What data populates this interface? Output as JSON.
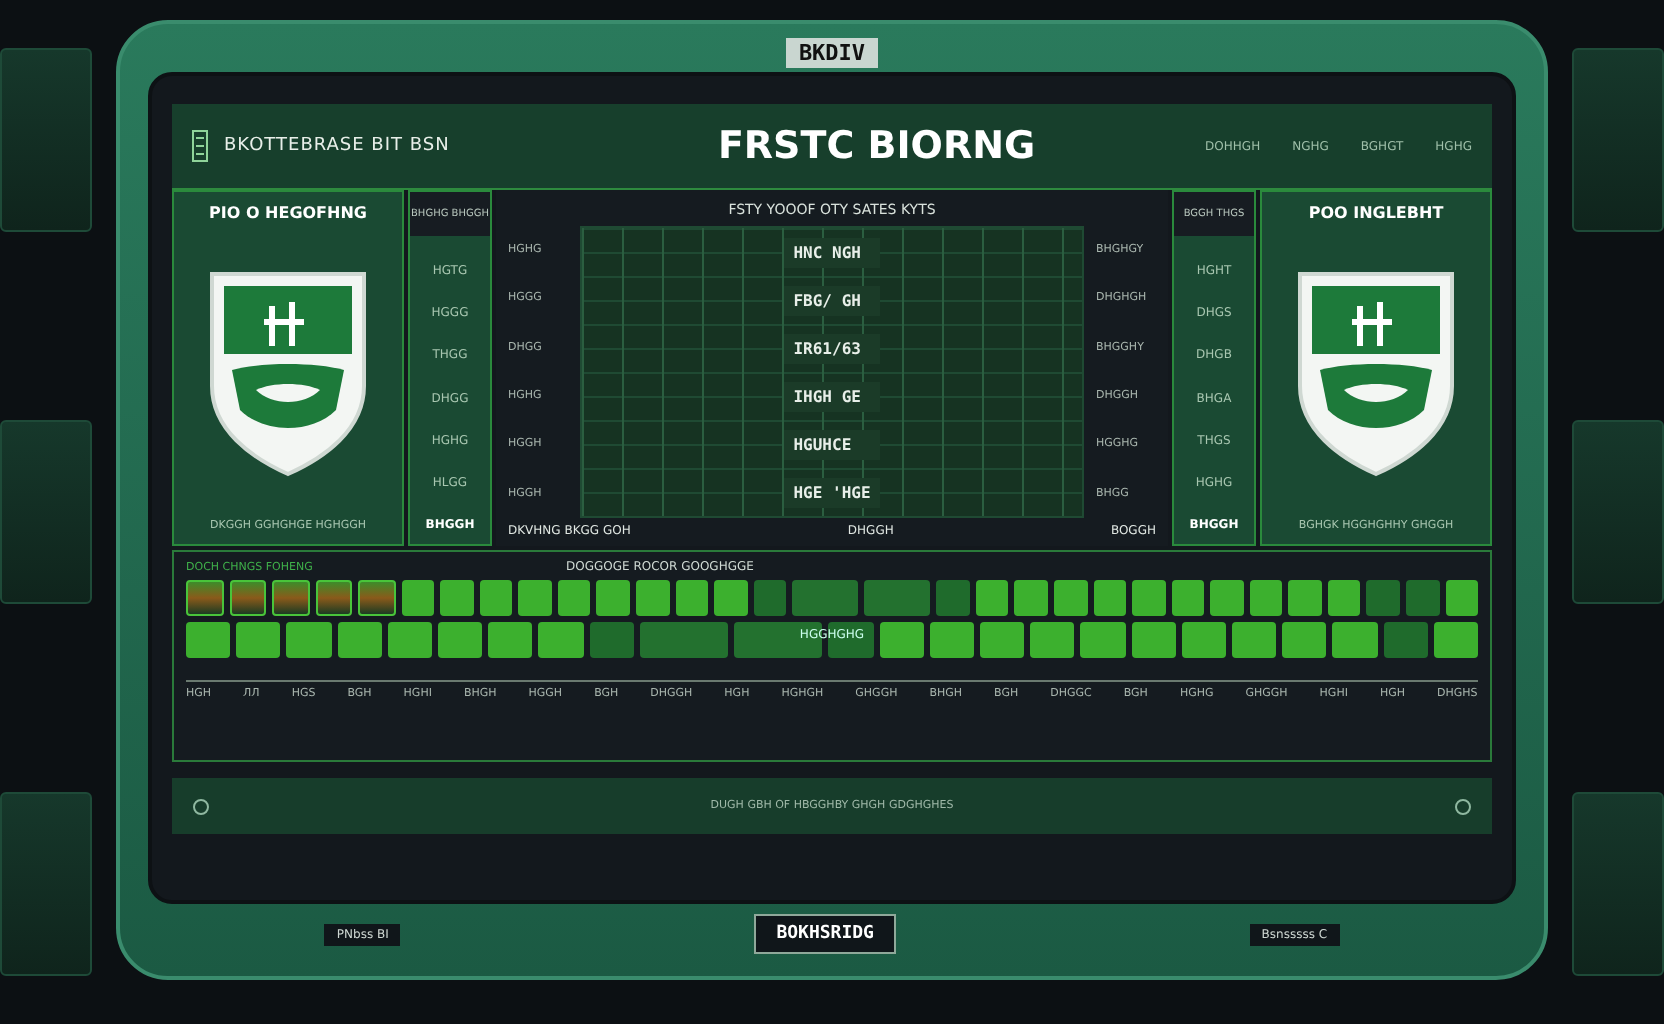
{
  "bezel": {
    "plate_label": "BKDIV",
    "bottom_label": "BOKHSRIDG",
    "bottom_left": "PNbss BI",
    "bottom_right": "Bsnsssss C"
  },
  "header": {
    "brand": "BKOTTEBRASE BIT BSN",
    "title": "FRSTC BIORNG",
    "nav": [
      "DOHHGH",
      "NGHG",
      "BGHGT",
      "HGHG"
    ]
  },
  "left_team": {
    "name": "PIO O HEGOFHNG",
    "caption": "DKGGH GGHGHGE HGHGGH"
  },
  "right_team": {
    "name": "POO INGLEBHT",
    "caption": "BGHGK HGGHGHHY GHGGH"
  },
  "left_stats": {
    "header": "BHGHG BHGGH",
    "items": [
      "HGTG",
      "HGGG",
      "THGG",
      "DHGG",
      "HGHG",
      "HLGG"
    ],
    "footer": "BHGGH"
  },
  "chart": {
    "title": "FSTY YOOOF OTY SATES KYTS",
    "subtitle": "DHGGH",
    "left_labels": [
      "HGHG",
      "HGGG",
      "DHGG",
      "HGHG",
      "HGGH",
      "HGGH"
    ],
    "rows": [
      "HNC NGH",
      "FBG/ GH",
      "IR61/63",
      "IHGH GE",
      "HGUHCE",
      "HGE 'HGE"
    ],
    "right_labels": [
      "BHGHGY",
      "DHGHGH",
      "BHGGHY",
      "DHGGH",
      "HGGHG",
      "BHGG"
    ],
    "footer_left": "DKVHNG BKGG GOH",
    "footer_right": "BOGGH"
  },
  "right_stats": {
    "header": "BGGH THGS",
    "items": [
      "HGHT",
      "DHGS",
      "DHGB",
      "BHGA",
      "THGS",
      "HGHG"
    ],
    "footer": "BHGGH"
  },
  "timeline": {
    "legend": "DOCH CHNGS FOHENG",
    "title": "DOGGOGE ROCOR GOOGHGGE",
    "row_1": [
      {
        "kind": "mixed"
      },
      {
        "kind": "mixed"
      },
      {
        "kind": "mixed"
      },
      {
        "kind": "mixed"
      },
      {
        "kind": "mixed"
      },
      {
        "kind": "bright"
      },
      {
        "kind": "bright"
      },
      {
        "kind": "bright"
      },
      {
        "kind": "bright"
      },
      {
        "kind": "bright"
      },
      {
        "kind": "bright"
      },
      {
        "kind": "bright"
      },
      {
        "kind": "bright"
      },
      {
        "kind": "bright"
      },
      {
        "kind": "dim"
      },
      {
        "kind": "wide"
      },
      {
        "kind": "wide"
      },
      {
        "kind": "dim"
      },
      {
        "kind": "bright"
      },
      {
        "kind": "bright"
      },
      {
        "kind": "bright"
      },
      {
        "kind": "bright"
      },
      {
        "kind": "bright"
      },
      {
        "kind": "bright"
      },
      {
        "kind": "bright"
      },
      {
        "kind": "bright"
      },
      {
        "kind": "bright"
      },
      {
        "kind": "bright"
      },
      {
        "kind": "dim"
      },
      {
        "kind": "dim"
      },
      {
        "kind": "bright"
      }
    ],
    "row_2": [
      {
        "kind": "bright"
      },
      {
        "kind": "bright"
      },
      {
        "kind": "bright"
      },
      {
        "kind": "bright"
      },
      {
        "kind": "bright"
      },
      {
        "kind": "bright"
      },
      {
        "kind": "bright"
      },
      {
        "kind": "bright"
      },
      {
        "kind": "dim"
      },
      {
        "kind": "wide"
      },
      {
        "kind": "wide"
      },
      {
        "kind": "dim"
      },
      {
        "kind": "bright"
      },
      {
        "kind": "bright"
      },
      {
        "kind": "bright"
      },
      {
        "kind": "bright"
      },
      {
        "kind": "bright"
      },
      {
        "kind": "bright"
      },
      {
        "kind": "bright"
      },
      {
        "kind": "bright"
      },
      {
        "kind": "bright"
      },
      {
        "kind": "bright"
      },
      {
        "kind": "dim"
      },
      {
        "kind": "bright"
      }
    ],
    "marker_label": "HGGHGHG",
    "axis_labels": [
      "HGH",
      "ЛЛ",
      "HGS",
      "BGH",
      "HGHI",
      "BHGH",
      "HGGH",
      "BGH",
      "DHGGH",
      "HGH",
      "HGHGH",
      "GHGGH",
      "BHGH",
      "BGH",
      "DHGGC",
      "BGH",
      "HGHG",
      "GHGGH",
      "HGHI",
      "HGH",
      "DHGHS"
    ]
  },
  "footer": {
    "text": "DUGH GBH OF HBGGHBY GHGH GDGHGHES"
  }
}
